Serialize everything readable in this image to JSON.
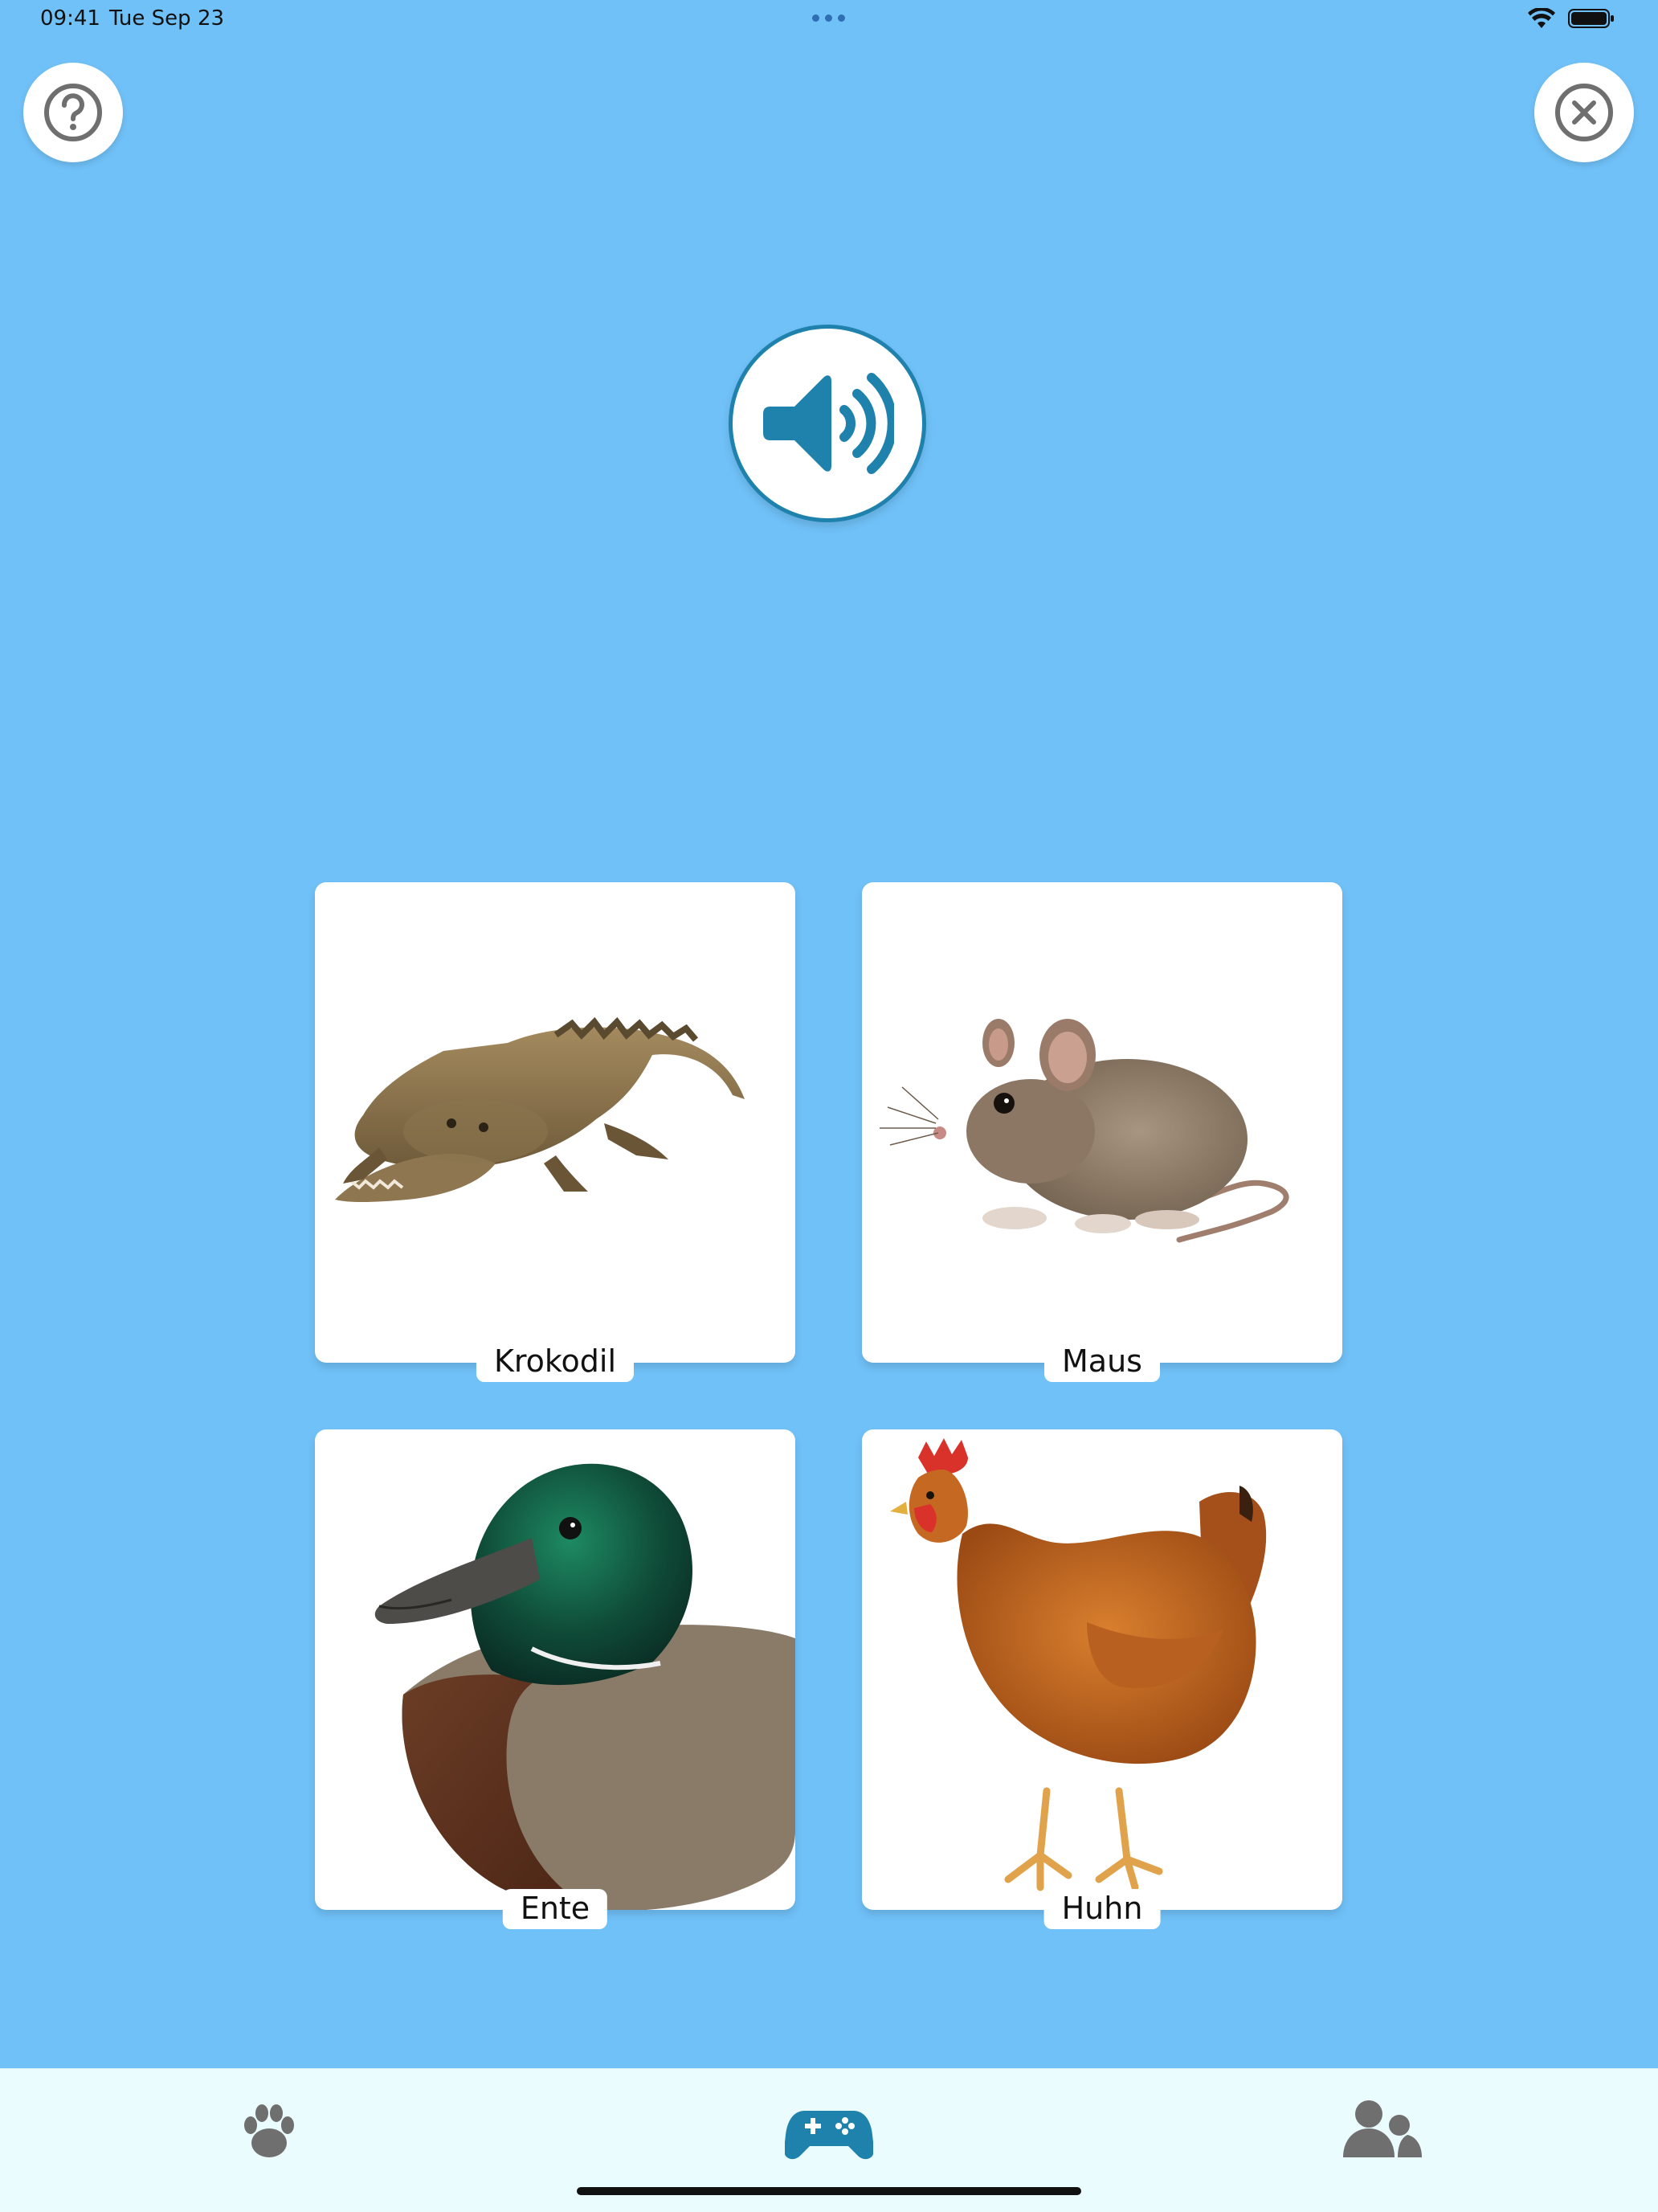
{
  "status_bar": {
    "time": "09:41",
    "date": "Tue Sep 23",
    "icons": [
      "wifi-icon",
      "battery-icon"
    ]
  },
  "top_bar": {
    "help_icon": "question-circle-icon",
    "close_icon": "close-circle-icon"
  },
  "sound_button": {
    "icon": "speaker-volume-icon"
  },
  "cards": [
    {
      "label": "Krokodil",
      "image": "crocodile"
    },
    {
      "label": "Maus",
      "image": "mouse"
    },
    {
      "label": "Ente",
      "image": "duck"
    },
    {
      "label": "Huhn",
      "image": "hen"
    }
  ],
  "tab_bar": {
    "tabs": [
      {
        "icon": "paw-icon",
        "selected": false
      },
      {
        "icon": "gamepad-icon",
        "selected": true
      },
      {
        "icon": "users-icon",
        "selected": false
      }
    ]
  },
  "colors": {
    "background": "#70c1f8",
    "accent": "#1f82ad",
    "icon_gray": "#6f6f6f",
    "tab_bar_bg": "#eafcfd"
  }
}
